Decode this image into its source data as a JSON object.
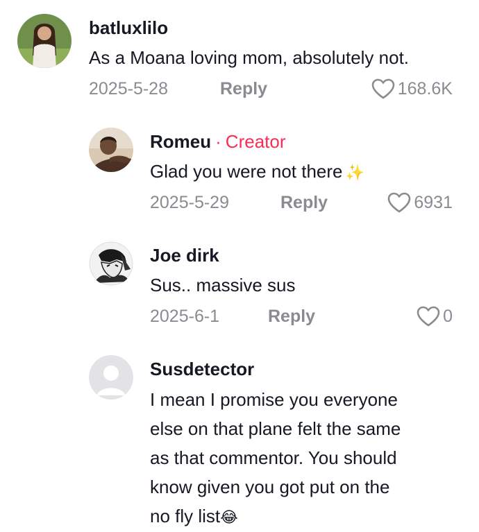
{
  "comments": [
    {
      "username": "batluxlilo",
      "text": "As a Moana loving mom, absolutely not.",
      "date": "2025-5-28",
      "reply_label": "Reply",
      "likes": "168.6K"
    },
    {
      "username": "Romeu",
      "separator": "·",
      "badge": "Creator",
      "text": "Glad you were not there",
      "emoji": "✨",
      "date": "2025-5-29",
      "reply_label": "Reply",
      "likes": "6931"
    },
    {
      "username": "Joe dirk",
      "text": "Sus.. massive sus",
      "date": "2025-6-1",
      "reply_label": "Reply",
      "likes": "0"
    },
    {
      "username": "Susdetector",
      "text_lines": [
        "I mean I promise you everyone",
        "else on that plane felt the same",
        "as that commentor. You should",
        "know given you got put on the",
        "no fly list"
      ],
      "emoji": "😂"
    }
  ],
  "icons": {
    "like": "heart-outline-icon",
    "default_avatar": "person-silhouette-icon"
  },
  "colors": {
    "accent": "#fe2c55",
    "muted": "#8a8b91",
    "text": "#161823"
  }
}
